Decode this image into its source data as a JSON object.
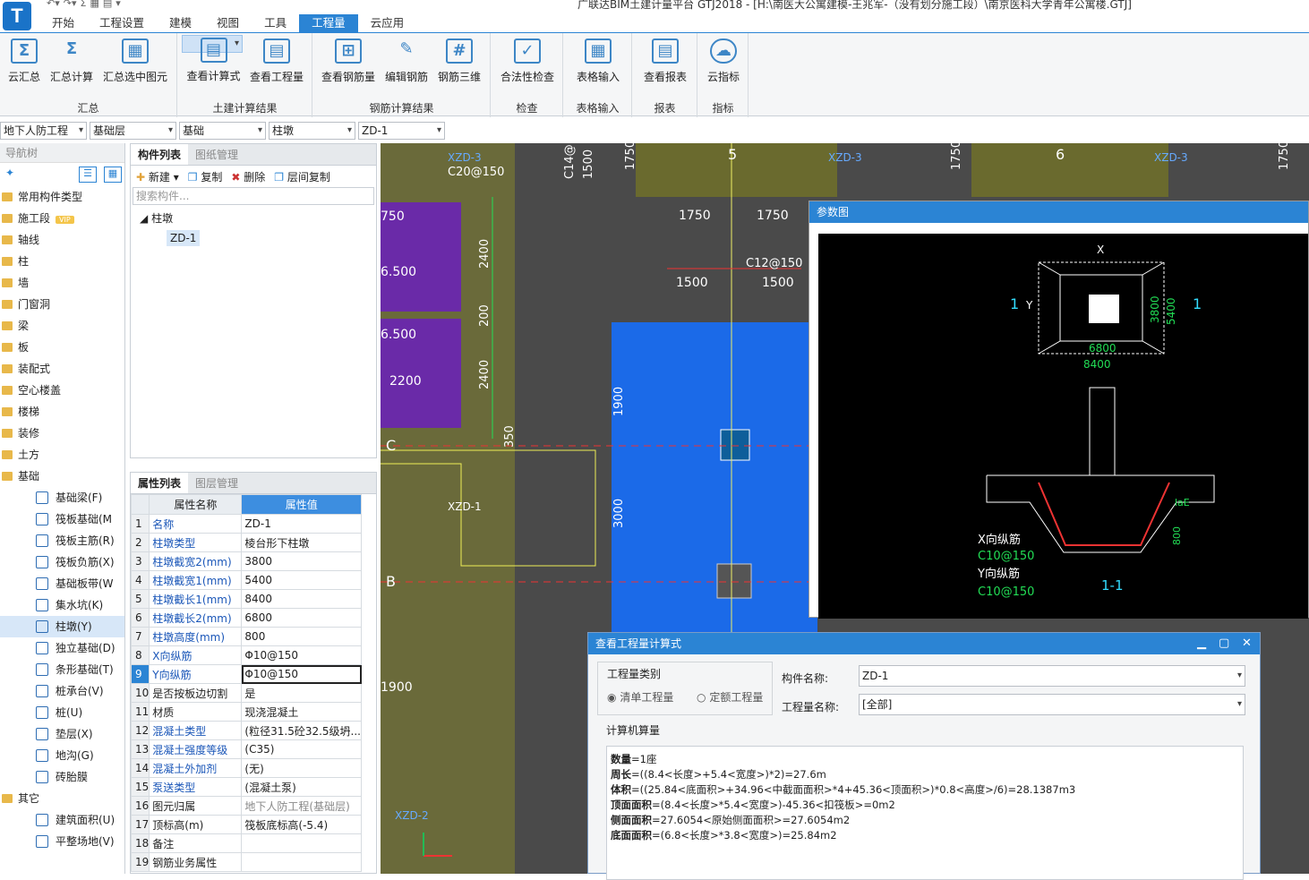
{
  "app": {
    "logo": "T",
    "title": "广联达BIM土建计量平台 GTJ2018 - [H:\\南医大公寓建模-王兆军-（没有划分施工段）\\南京医科大学青年公寓楼.GTJ]",
    "menus": [
      "开始",
      "工程设置",
      "建模",
      "视图",
      "工具",
      "工程量",
      "云应用"
    ],
    "active_menu": "工程量"
  },
  "ribbon": {
    "groups": [
      {
        "label": "汇总",
        "buttons": [
          "云汇总",
          "汇总计算",
          "汇总选中图元"
        ]
      },
      {
        "label": "土建计算结果",
        "buttons": [
          "查看计算式",
          "查看工程量"
        ]
      },
      {
        "label": "钢筋计算结果",
        "buttons": [
          "查看钢筋量",
          "编辑钢筋",
          "钢筋三维"
        ]
      },
      {
        "label": "检查",
        "buttons": [
          "合法性检查"
        ]
      },
      {
        "label": "表格输入",
        "buttons": [
          "表格输入"
        ]
      },
      {
        "label": "报表",
        "buttons": [
          "查看报表"
        ]
      },
      {
        "label": "指标",
        "buttons": [
          "云指标"
        ]
      }
    ],
    "selected": "查看计算式"
  },
  "selectors": [
    "地下人防工程",
    "基础层",
    "基础",
    "柱墩",
    "ZD-1"
  ],
  "nav": {
    "title": "导航树",
    "items": [
      "常用构件类型",
      "施工段",
      "轴线",
      "柱",
      "墙",
      "门窗洞",
      "梁",
      "板",
      "装配式",
      "空心楼盖",
      "楼梯",
      "装修",
      "土方",
      "基础"
    ],
    "vip": "VIP",
    "sub": [
      "基础梁(F)",
      "筏板基础(M",
      "筏板主筋(R)",
      "筏板负筋(X)",
      "基础板带(W",
      "集水坑(K)",
      "柱墩(Y)",
      "独立基础(D)",
      "条形基础(T)",
      "桩承台(V)",
      "桩(U)",
      "垫层(X)",
      "地沟(G)",
      "砖胎膜"
    ],
    "selected_sub": "柱墩(Y)",
    "other": "其它",
    "other_sub": [
      "建筑面积(U)",
      "平整场地(V)"
    ]
  },
  "components": {
    "tabs": [
      "构件列表",
      "图纸管理"
    ],
    "toolbar": [
      "新建",
      "复制",
      "删除",
      "层间复制"
    ],
    "search_placeholder": "搜索构件...",
    "tree_root": "柱墩",
    "tree_item": "ZD-1"
  },
  "properties": {
    "tabs": [
      "属性列表",
      "图层管理"
    ],
    "headers": [
      "属性名称",
      "属性值"
    ],
    "rows": [
      {
        "n": "1",
        "name": "名称",
        "value": "ZD-1"
      },
      {
        "n": "2",
        "name": "柱墩类型",
        "value": "棱台形下柱墩"
      },
      {
        "n": "3",
        "name": "柱墩截宽2(mm)",
        "value": "3800"
      },
      {
        "n": "4",
        "name": "柱墩截宽1(mm)",
        "value": "5400"
      },
      {
        "n": "5",
        "name": "柱墩截长1(mm)",
        "value": "8400"
      },
      {
        "n": "6",
        "name": "柱墩截长2(mm)",
        "value": "6800"
      },
      {
        "n": "7",
        "name": "柱墩高度(mm)",
        "value": "800"
      },
      {
        "n": "8",
        "name": "X向纵筋",
        "value": "Φ10@150"
      },
      {
        "n": "9",
        "name": "Y向纵筋",
        "value": "Φ10@150"
      },
      {
        "n": "10",
        "name": "是否按板边切割",
        "value": "是"
      },
      {
        "n": "11",
        "name": "材质",
        "value": "现浇混凝土"
      },
      {
        "n": "12",
        "name": "混凝土类型",
        "value": "(粒径31.5砼32.5级坍..."
      },
      {
        "n": "13",
        "name": "混凝土强度等级",
        "value": "(C35)"
      },
      {
        "n": "14",
        "name": "混凝土外加剂",
        "value": "(无)"
      },
      {
        "n": "15",
        "name": "泵送类型",
        "value": "(混凝土泵)"
      },
      {
        "n": "16",
        "name": "图元归属",
        "value": "地下人防工程(基础层)"
      },
      {
        "n": "17",
        "name": "顶标高(m)",
        "value": "筏板底标高(-5.4)"
      },
      {
        "n": "18",
        "name": "备注",
        "value": ""
      },
      {
        "n": "19",
        "name": "钢筋业务属性",
        "value": ""
      }
    ]
  },
  "canvas": {
    "axis_labels": [
      "5",
      "6",
      "C",
      "B"
    ],
    "dims": [
      "1750",
      "1750",
      "1750",
      "1750",
      "1500",
      "1500",
      "2400",
      "200",
      "2400",
      "350",
      "1900",
      "3000",
      "1900",
      "750",
      "6.500",
      "6.500",
      "2200"
    ],
    "rebar_labels": [
      "C12@150",
      "C20@150",
      "C14@1",
      "XZD-3",
      "XZD-3",
      "XZD-3",
      "XZD-1",
      "XZD-2"
    ]
  },
  "param_dialog": {
    "title": "参数图",
    "x": "X",
    "y": "Y",
    "section_marks": [
      "1",
      "1"
    ],
    "dim_3800": "3800",
    "dim_5400": "5400",
    "dim_6800": "6800",
    "dim_8400": "8400",
    "x_rebar": "X向纵筋",
    "x_rebar_spec": "C10@150",
    "y_rebar": "Y向纵筋",
    "y_rebar_spec": "C10@150",
    "lae": "laE",
    "height": "800",
    "section_title": "1-1"
  },
  "calc_dialog": {
    "title": "查看工程量计算式",
    "category_label": "工程量类别",
    "options": [
      "清单工程量",
      "定额工程量"
    ],
    "component_label": "构件名称:",
    "component_value": "ZD-1",
    "qty_label": "工程量名称:",
    "qty_value": "[全部]",
    "computer_label": "计算机算量",
    "lines": [
      {
        "k": "数量",
        "v": "=1座"
      },
      {
        "k": "周长",
        "v": "=((8.4<长度>+5.4<宽度>)*2)=27.6m"
      },
      {
        "k": "体积",
        "v": "=((25.84<底面积>+34.96<中截面面积>*4+45.36<顶面积>)*0.8<高度>/6)=28.1387m3"
      },
      {
        "k": "顶面面积",
        "v": "=(8.4<长度>*5.4<宽度>)-45.36<扣筏板>=0m2"
      },
      {
        "k": "侧面面积",
        "v": "=27.6054<原始侧面面积>=27.6054m2"
      },
      {
        "k": "底面面积",
        "v": "=(6.8<长度>*3.8<宽度>)=25.84m2"
      }
    ]
  }
}
